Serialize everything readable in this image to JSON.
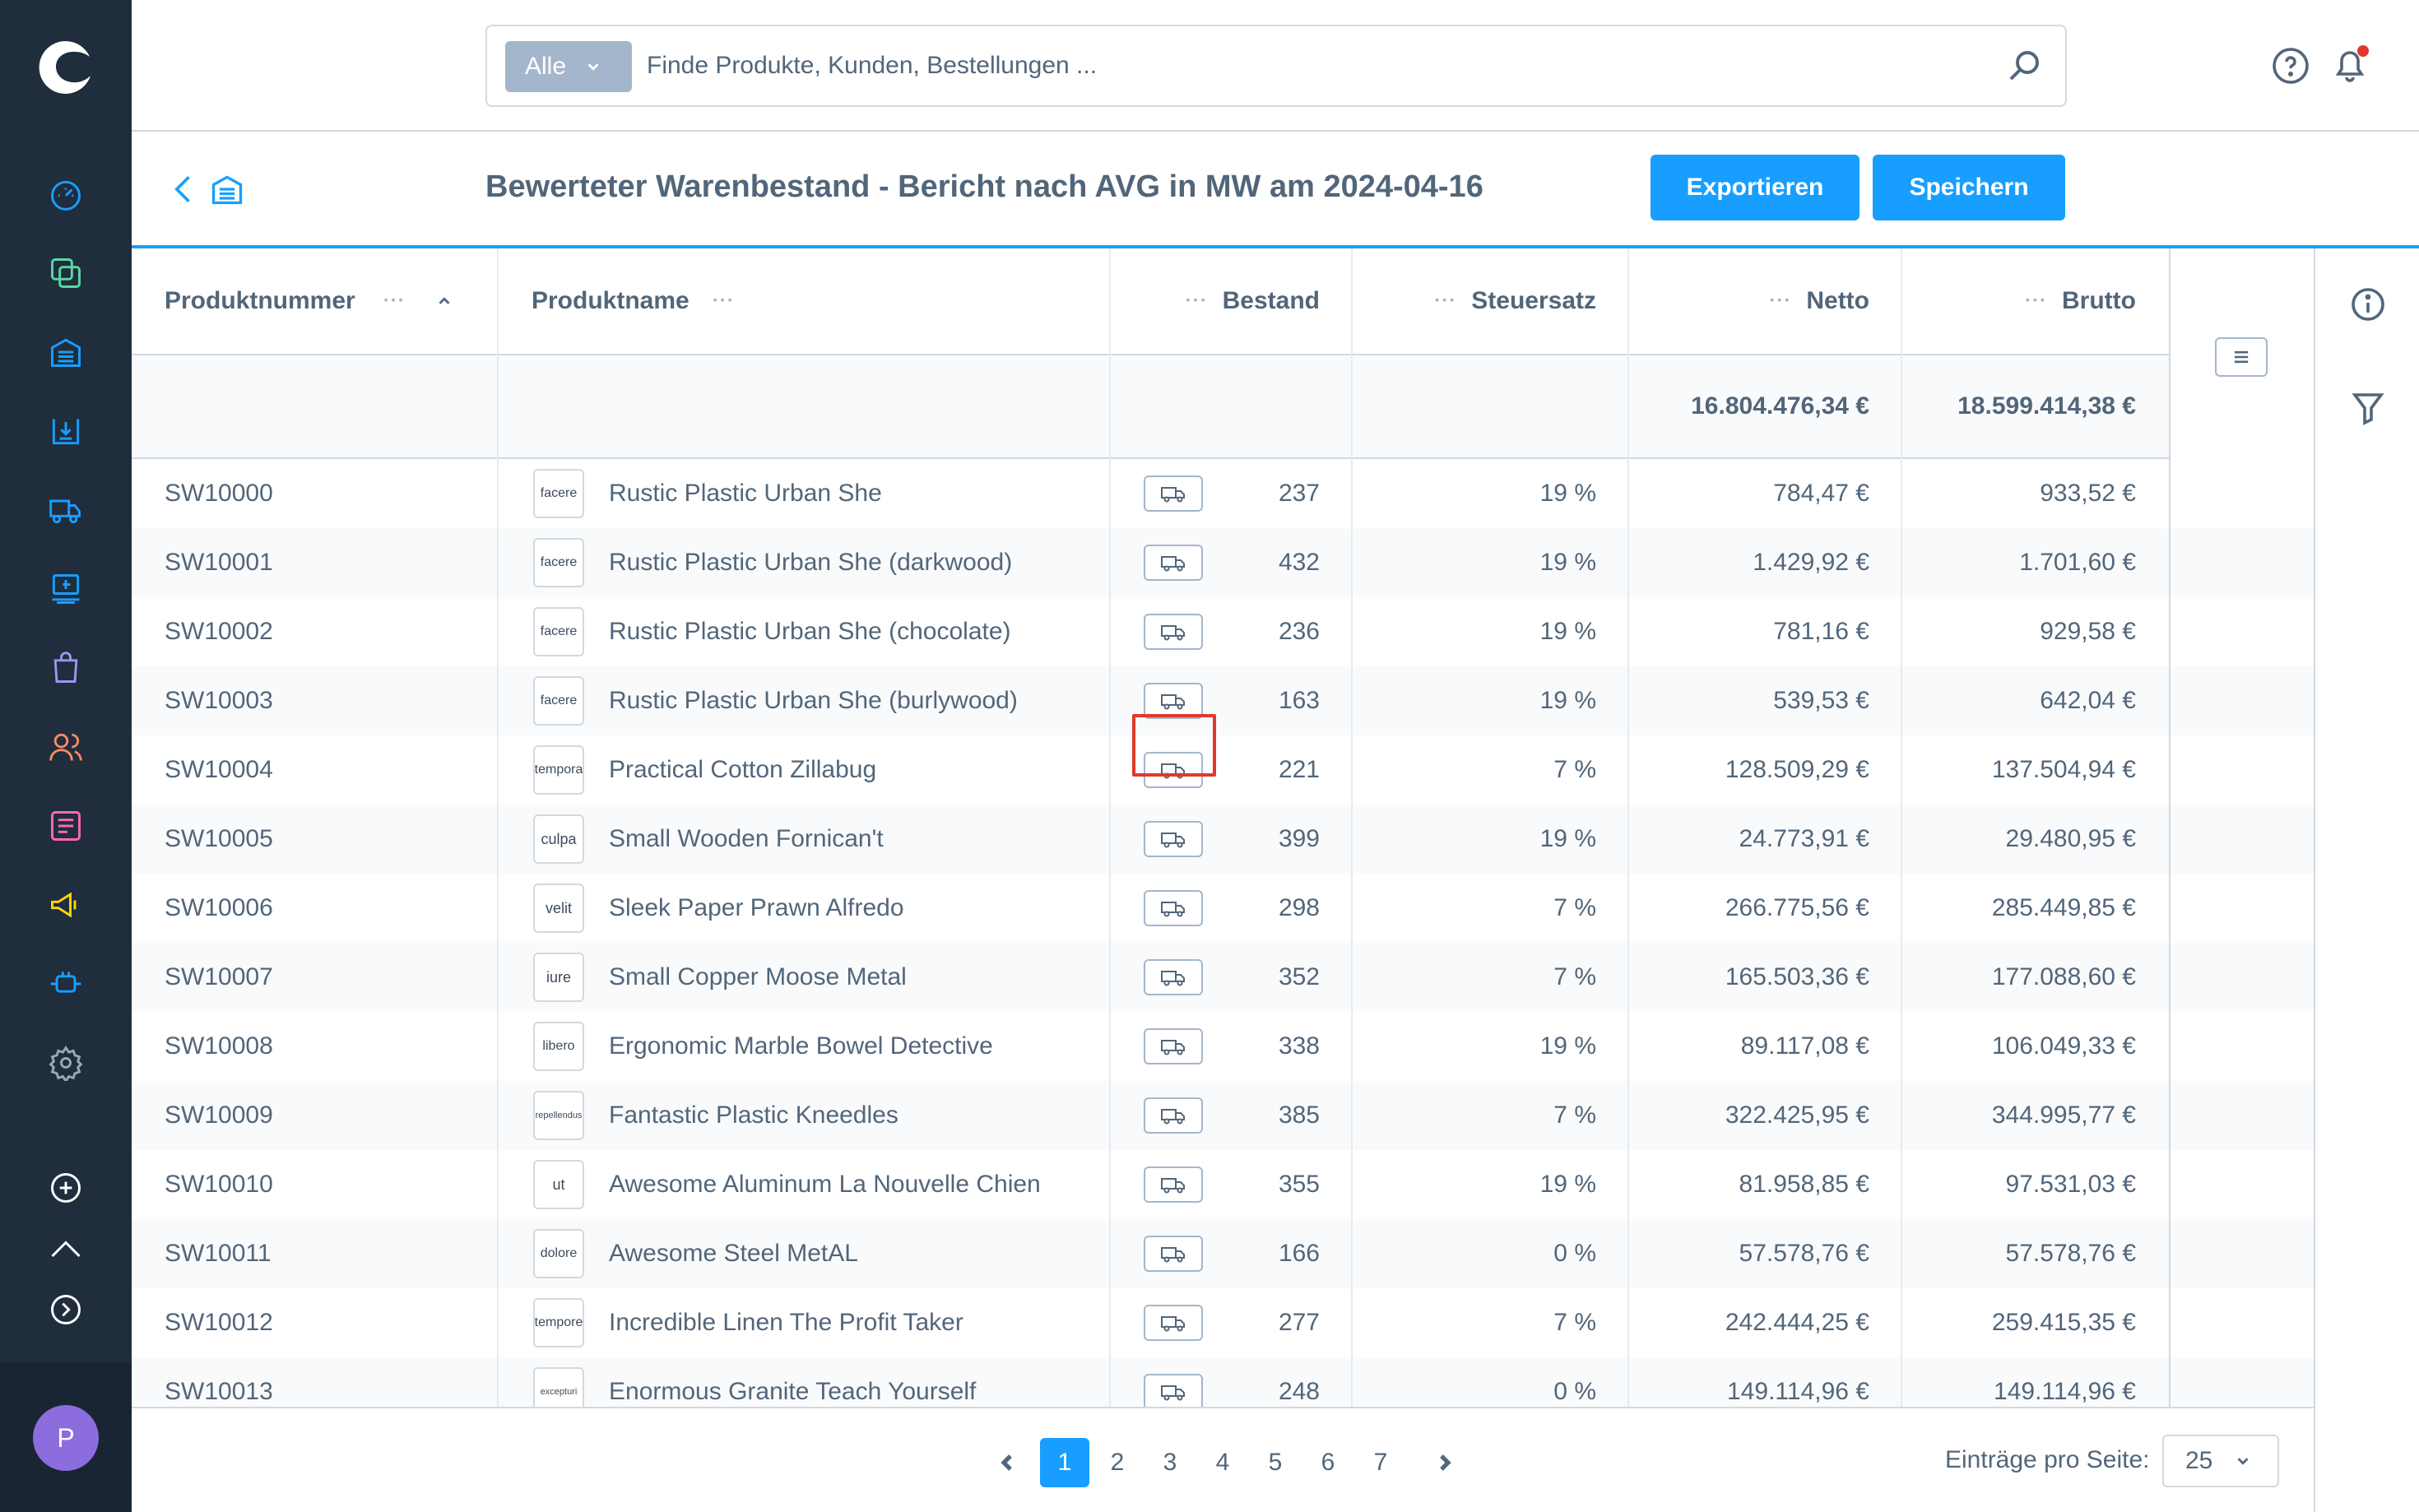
{
  "topbar": {
    "search_type_label": "Alle",
    "search_placeholder": "Finde Produkte, Kunden, Bestellungen ..."
  },
  "smartbar": {
    "title": "Bewerteter Warenbestand - Bericht nach AVG in MW am 2024-04-16",
    "export_label": "Exportieren",
    "save_label": "Speichern"
  },
  "columns": {
    "product_number": "Produktnummer",
    "product_name": "Produktname",
    "stock": "Bestand",
    "tax_rate": "Steuersatz",
    "net": "Netto",
    "gross": "Brutto"
  },
  "totals": {
    "net": "16.804.476,34 €",
    "gross": "18.599.414,38 €"
  },
  "rows": [
    {
      "number": "SW10000",
      "thumb": "facere",
      "name": "Rustic Plastic Urban She",
      "stock": "237",
      "tax": "19 %",
      "net": "784,47 €",
      "gross": "933,52 €"
    },
    {
      "number": "SW10001",
      "thumb": "facere",
      "name": "Rustic Plastic Urban She (darkwood)",
      "stock": "432",
      "tax": "19 %",
      "net": "1.429,92 €",
      "gross": "1.701,60 €"
    },
    {
      "number": "SW10002",
      "thumb": "facere",
      "name": "Rustic Plastic Urban She (chocolate)",
      "stock": "236",
      "tax": "19 %",
      "net": "781,16 €",
      "gross": "929,58 €"
    },
    {
      "number": "SW10003",
      "thumb": "facere",
      "name": "Rustic Plastic Urban She (burlywood)",
      "stock": "163",
      "tax": "19 %",
      "net": "539,53 €",
      "gross": "642,04 €"
    },
    {
      "number": "SW10004",
      "thumb": "tempora",
      "name": "Practical Cotton Zillabug",
      "stock": "221",
      "tax": "7 %",
      "net": "128.509,29 €",
      "gross": "137.504,94 €"
    },
    {
      "number": "SW10005",
      "thumb": "culpa",
      "name": "Small Wooden Fornican't",
      "stock": "399",
      "tax": "19 %",
      "net": "24.773,91 €",
      "gross": "29.480,95 €"
    },
    {
      "number": "SW10006",
      "thumb": "velit",
      "name": "Sleek Paper Prawn Alfredo",
      "stock": "298",
      "tax": "7 %",
      "net": "266.775,56 €",
      "gross": "285.449,85 €"
    },
    {
      "number": "SW10007",
      "thumb": "iure",
      "name": "Small Copper Moose Metal",
      "stock": "352",
      "tax": "7 %",
      "net": "165.503,36 €",
      "gross": "177.088,60 €"
    },
    {
      "number": "SW10008",
      "thumb": "libero",
      "name": "Ergonomic Marble Bowel Detective",
      "stock": "338",
      "tax": "19 %",
      "net": "89.117,08 €",
      "gross": "106.049,33 €"
    },
    {
      "number": "SW10009",
      "thumb": "repellendus",
      "name": "Fantastic Plastic Kneedles",
      "stock": "385",
      "tax": "7 %",
      "net": "322.425,95 €",
      "gross": "344.995,77 €"
    },
    {
      "number": "SW10010",
      "thumb": "ut",
      "name": "Awesome Aluminum La Nouvelle Chien",
      "stock": "355",
      "tax": "19 %",
      "net": "81.958,85 €",
      "gross": "97.531,03 €"
    },
    {
      "number": "SW10011",
      "thumb": "dolore",
      "name": "Awesome Steel MetAL",
      "stock": "166",
      "tax": "0 %",
      "net": "57.578,76 €",
      "gross": "57.578,76 €"
    },
    {
      "number": "SW10012",
      "thumb": "tempore",
      "name": "Incredible Linen The Profit Taker",
      "stock": "277",
      "tax": "7 %",
      "net": "242.444,25 €",
      "gross": "259.415,35 €"
    },
    {
      "number": "SW10013",
      "thumb": "excepturi",
      "name": "Enormous Granite Teach Yourself",
      "stock": "248",
      "tax": "0 %",
      "net": "149.114,96 €",
      "gross": "149.114,96 €"
    }
  ],
  "pagination": {
    "pages": [
      "1",
      "2",
      "3",
      "4",
      "5",
      "6",
      "7"
    ],
    "current": "1",
    "per_page_label": "Einträge pro Seite:",
    "per_page_value": "25"
  },
  "user": {
    "avatar_initial": "P"
  },
  "colors": {
    "accent": "#189eff",
    "sidebar": "#1f2d3d",
    "highlight": "#e0392b"
  }
}
